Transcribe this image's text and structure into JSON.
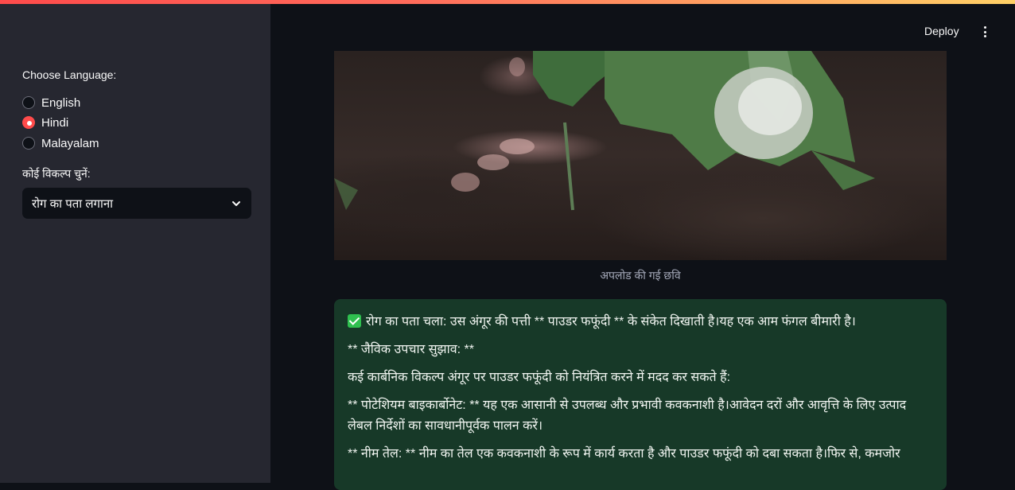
{
  "sidebar": {
    "language_label": "Choose Language:",
    "languages": [
      {
        "label": "English",
        "selected": false
      },
      {
        "label": "Hindi",
        "selected": true
      },
      {
        "label": "Malayalam",
        "selected": false
      }
    ],
    "option_label": "कोई विकल्प चुनें:",
    "option_value": "रोग का पता लगाना"
  },
  "header": {
    "deploy_label": "Deploy",
    "menu_icon": "kebab-menu-icon"
  },
  "main": {
    "image_caption": "अपलोड की गई छवि",
    "result": {
      "status_icon": "check-box-icon",
      "paragraphs": [
        "रोग का पता चला: उस अंगूर की पत्ती ** पाउडर फफूंदी ** के संकेत दिखाती है।यह एक आम फंगल बीमारी है।",
        "** जैविक उपचार सुझाव: **",
        "कई कार्बनिक विकल्प अंगूर पर पाउडर फफूंदी को नियंत्रित करने में मदद कर सकते हैं:",
        "** पोटेशियम बाइकार्बोनेट: ** यह एक आसानी से उपलब्ध और प्रभावी कवकनाशी है।आवेदन दरों और आवृत्ति के लिए उत्पाद लेबल निर्देशों का सावधानीपूर्वक पालन करें।",
        "** नीम तेल: ** नीम का तेल एक कवकनाशी के रूप में कार्य करता है और पाउडर फफूंदी को दबा सकता है।फिर से, कमजोर"
      ]
    }
  },
  "colors": {
    "accent": "#ff4b4b",
    "sidebar_bg": "#262730",
    "main_bg": "#0e1117",
    "result_bg": "#173928",
    "success": "#2fbf4f"
  }
}
